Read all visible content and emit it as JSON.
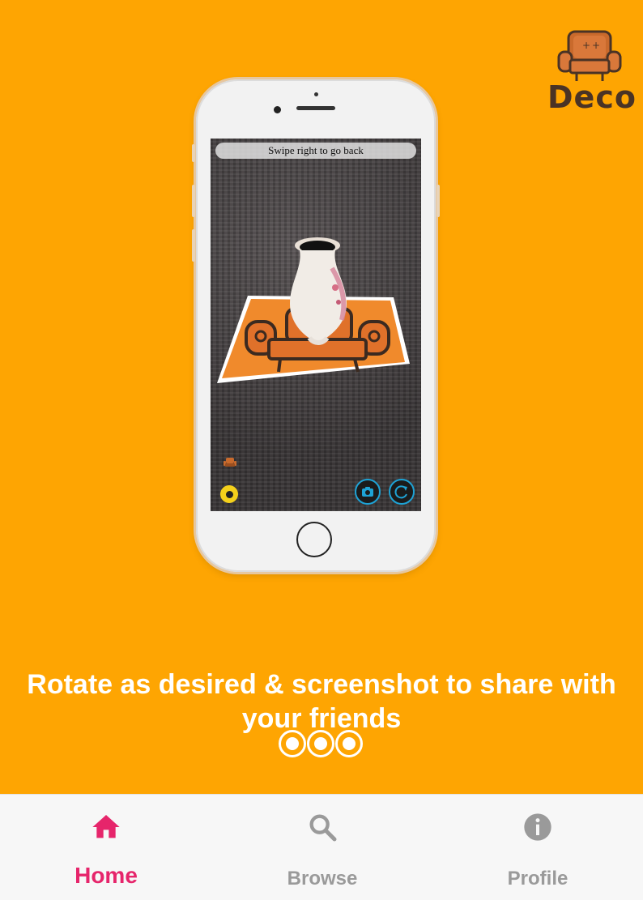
{
  "brand": {
    "name": "Deco"
  },
  "phone_screen": {
    "banner_text": "Swipe right to go back"
  },
  "caption": "Rotate as desired & screenshot to share with your friends",
  "pagination": {
    "count": 3
  },
  "bottom_nav": {
    "items": [
      {
        "label": "Home",
        "icon": "home-icon",
        "active": true
      },
      {
        "label": "Browse",
        "icon": "search-icon",
        "active": false
      },
      {
        "label": "Profile",
        "icon": "info-icon",
        "active": false
      }
    ]
  },
  "colors": {
    "background": "#FEA502",
    "active_nav": "#E6256B",
    "inactive_nav": "#9A9A9A",
    "accent_blue": "#1EA3D6"
  }
}
